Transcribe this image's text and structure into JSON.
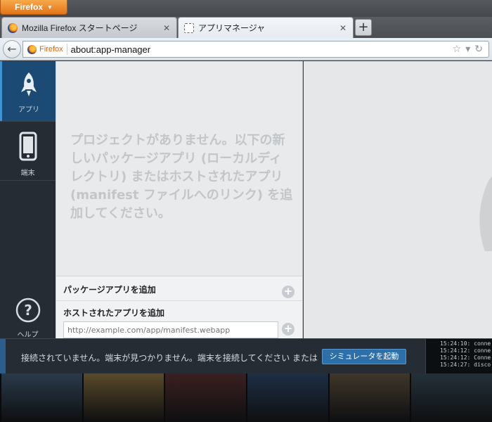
{
  "browser": {
    "menu_button": "Firefox",
    "tabs": [
      {
        "label": "Mozilla Firefox スタートページ"
      },
      {
        "label": "アプリマネージャ"
      }
    ],
    "identity_label": "Firefox",
    "url": "about:app-manager"
  },
  "sidebar": {
    "apps_label": "アプリ",
    "device_label": "端末",
    "help_label": "ヘルプ"
  },
  "projects": {
    "empty_message": "プロジェクトがありません。以下の新しいパッケージアプリ (ローカルディレクトリ) またはホストされたアプリ (manifest ファイルへのリンク) を追加してください。",
    "add_packaged_label": "パッケージアプリを追加",
    "add_hosted_label": "ホストされたアプリを追加",
    "hosted_placeholder": "http://example.com/app/manifest.webapp"
  },
  "connection": {
    "status_text": "接続されていません。端末が見つかりません。端末を接続してください または",
    "simulator_button": "シミュレータを起動",
    "log": [
      "15:24:10: conne",
      "15:24:12: conne",
      "15:24:12: Conne",
      "15:24:27: disco"
    ]
  },
  "colors": {
    "sidebar_bg": "#252c33",
    "sidebar_selected": "#1b4a74",
    "accent_button": "#2d6fa9",
    "firefox_orange": "#e66100"
  },
  "desktop_thumbs": [
    {
      "color": "#2a3a4a"
    },
    {
      "color": "#5a4a2a"
    },
    {
      "color": "#3a2020"
    },
    {
      "color": "#1e2f44"
    },
    {
      "color": "#40362a"
    },
    {
      "color": "#24313a"
    }
  ]
}
